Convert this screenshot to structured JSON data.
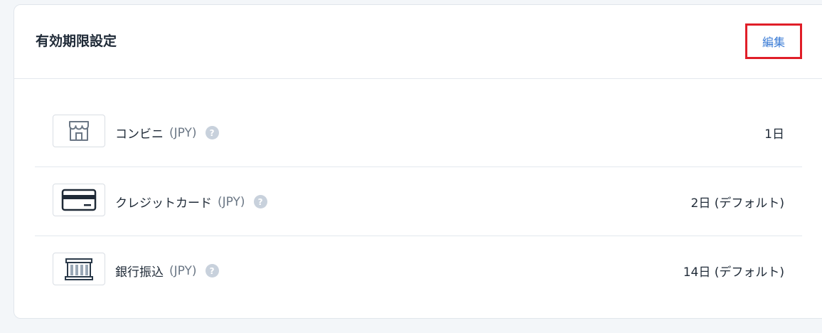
{
  "header": {
    "title": "有効期限設定",
    "edit_label": "編集"
  },
  "methods": [
    {
      "icon": "store-icon",
      "label": "コンビニ",
      "currency": "(JPY)",
      "help": "?",
      "value": "1日"
    },
    {
      "icon": "credit-card-icon",
      "label": "クレジットカード",
      "currency": "(JPY)",
      "help": "?",
      "value": "2日 (デフォルト)"
    },
    {
      "icon": "bank-icon",
      "label": "銀行振込",
      "currency": "(JPY)",
      "help": "?",
      "value": "14日 (デフォルト)"
    }
  ],
  "colors": {
    "accent_link": "#3a7bd5",
    "highlight_border": "#e01e28",
    "icon_stroke": "#2b3a4a"
  }
}
